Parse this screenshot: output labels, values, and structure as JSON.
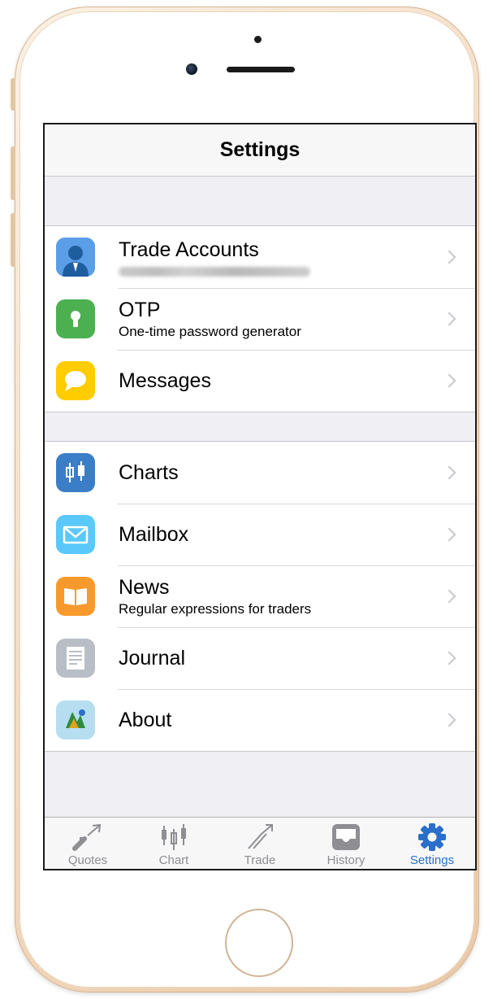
{
  "nav": {
    "title": "Settings"
  },
  "groups": [
    {
      "items": [
        {
          "title": "Trade Accounts",
          "subtitle": "",
          "icon": "person-icon",
          "color": "#4a90e2",
          "subtitle_blurred": true
        },
        {
          "title": "OTP",
          "subtitle": "One-time password generator",
          "icon": "keyhole-icon",
          "color": "#4cb050"
        },
        {
          "title": "Messages",
          "subtitle": "",
          "icon": "speech-bubble-icon",
          "color": "#ffcc00"
        }
      ]
    },
    {
      "items": [
        {
          "title": "Charts",
          "subtitle": "",
          "icon": "candlestick-icon",
          "color": "#3b7ec8"
        },
        {
          "title": "Mailbox",
          "subtitle": "",
          "icon": "envelope-icon",
          "color": "#5ac8fa"
        },
        {
          "title": "News",
          "subtitle": "Regular expressions for traders",
          "icon": "book-icon",
          "color": "#f79a2b"
        },
        {
          "title": "Journal",
          "subtitle": "",
          "icon": "document-icon",
          "color": "#b9bec6"
        },
        {
          "title": "About",
          "subtitle": "",
          "icon": "metatrader-logo-icon",
          "color": "#a5d3ea"
        }
      ]
    }
  ],
  "tabbar": {
    "active": "Settings",
    "tabs": [
      {
        "label": "Quotes",
        "icon": "quotes-arrows-icon"
      },
      {
        "label": "Chart",
        "icon": "candlestick-icon"
      },
      {
        "label": "Trade",
        "icon": "trade-trend-icon"
      },
      {
        "label": "History",
        "icon": "inbox-tray-icon"
      },
      {
        "label": "Settings",
        "icon": "gear-icon"
      }
    ]
  },
  "colors": {
    "accent": "#2a6fc9",
    "inactive": "#8e8e93",
    "background": "#efeff4",
    "phone_frame": "#e9c9a8"
  }
}
